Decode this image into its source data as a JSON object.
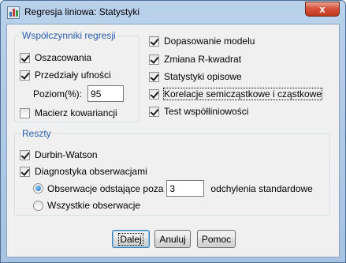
{
  "window": {
    "title": "Regresja liniowa: Statystyki",
    "close_glyph": "x"
  },
  "regression_coefficients": {
    "title": "Współczynniki regresji",
    "estimates": {
      "label": "Oszacowania",
      "checked": true
    },
    "confidence_intervals": {
      "label": "Przedziały ufności",
      "checked": true
    },
    "level_label": "Poziom(%):",
    "level_value": "95",
    "covariance_matrix": {
      "label": "Macierz kowariancji",
      "checked": false
    }
  },
  "right_options": [
    {
      "label": "Dopasowanie modelu",
      "checked": true
    },
    {
      "label": "Zmiana R-kwadrat",
      "checked": true
    },
    {
      "label": "Statystyki opisowe",
      "checked": true
    },
    {
      "label": "Korelacje semicząstkowe i cząstkowe",
      "checked": true
    },
    {
      "label": "Test współliniowości",
      "checked": true
    }
  ],
  "residuals": {
    "title": "Reszty",
    "durbin_watson": {
      "label": "Durbin-Watson",
      "checked": true
    },
    "casewise": {
      "label": "Diagnostyka obserwacjami",
      "checked": true
    },
    "outliers_label": "Obserwacje odstające poza",
    "outliers_value": "3",
    "outliers_suffix": "odchylenia standardowe",
    "outliers_selected": true,
    "all_cases_label": "Wszystkie obserwacje",
    "all_cases_selected": false
  },
  "buttons": {
    "next": "Dalej",
    "cancel": "Anuluj",
    "help": "Pomoc"
  }
}
